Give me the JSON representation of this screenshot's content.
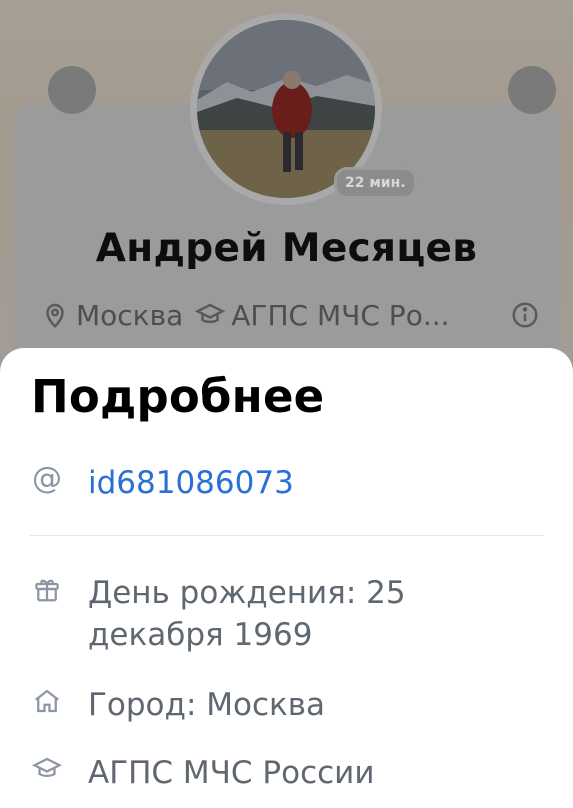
{
  "profile": {
    "name": "Андрей Месяцев",
    "status": "22 мин.",
    "city": "Москва",
    "education_short": "АГПС МЧС Ро..."
  },
  "details": {
    "title": "Подробнее",
    "id": "id681086073",
    "birthday": "День рождения: 25 декабря 1969",
    "city": "Город: Москва",
    "education": "АГПС МЧС России"
  },
  "icons": {
    "location": "location-pin-icon",
    "education": "graduation-cap-icon",
    "info": "info-icon",
    "mention": "at-sign-icon",
    "gift": "gift-icon",
    "home": "home-icon"
  },
  "colors": {
    "link": "#2a6fd6",
    "sheet_bg": "#ffffff",
    "overlay": "#9b9b9b"
  }
}
